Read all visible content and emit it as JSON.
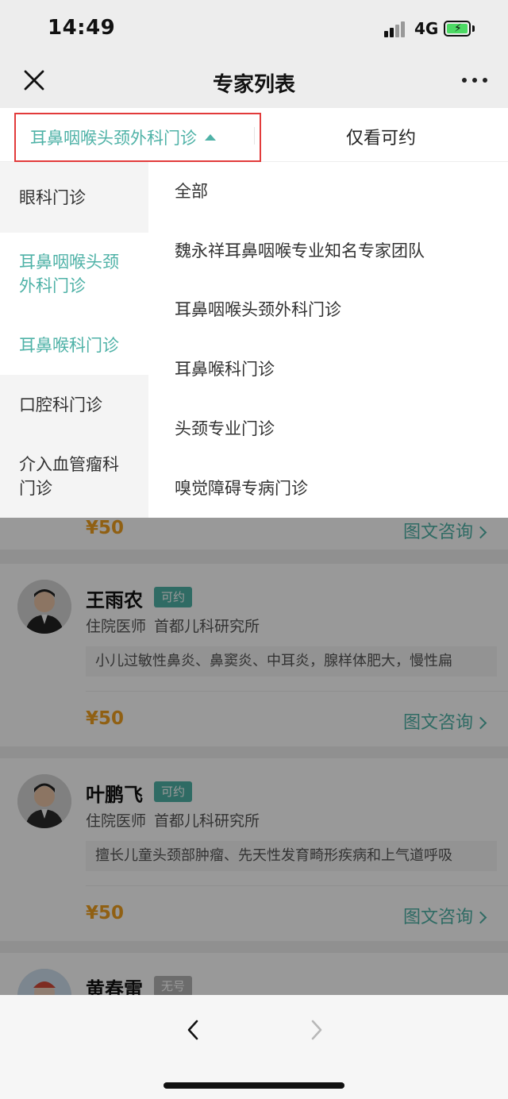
{
  "status_bar": {
    "time": "14:49",
    "network": "4G"
  },
  "nav": {
    "title": "专家列表"
  },
  "filter": {
    "department": "耳鼻咽喉头颈外科门诊",
    "available_only": "仅看可约"
  },
  "departments": [
    {
      "label": "眼科门诊"
    },
    {
      "label": "耳鼻咽喉头颈外科门诊"
    },
    {
      "label": "耳鼻喉科门诊"
    },
    {
      "label": "口腔科门诊"
    },
    {
      "label": "介入血管瘤科门诊"
    }
  ],
  "sub_departments": [
    {
      "label": "全部"
    },
    {
      "label": "魏永祥耳鼻咽喉专业知名专家团队"
    },
    {
      "label": "耳鼻咽喉头颈外科门诊"
    },
    {
      "label": "耳鼻喉科门诊"
    },
    {
      "label": "头颈专业门诊"
    },
    {
      "label": "嗅觉障碍专病门诊"
    }
  ],
  "doctors": [
    {
      "price": "¥50",
      "consult": "图文咨询"
    },
    {
      "name": "王雨农",
      "badge": "可约",
      "title": "住院医师",
      "hospital": "首都儿科研究所",
      "specialty": "小儿过敏性鼻炎、鼻窦炎、中耳炎，腺样体肥大，慢性扁",
      "price": "¥50",
      "consult": "图文咨询"
    },
    {
      "name": "叶鹏飞",
      "badge": "可约",
      "title": "住院医师",
      "hospital": "首都儿科研究所",
      "specialty": "擅长儿童头颈部肿瘤、先天性发育畸形疾病和上气道呼吸",
      "price": "¥50",
      "consult": "图文咨询"
    },
    {
      "name": "黄春雷",
      "badge": "无号"
    }
  ]
}
